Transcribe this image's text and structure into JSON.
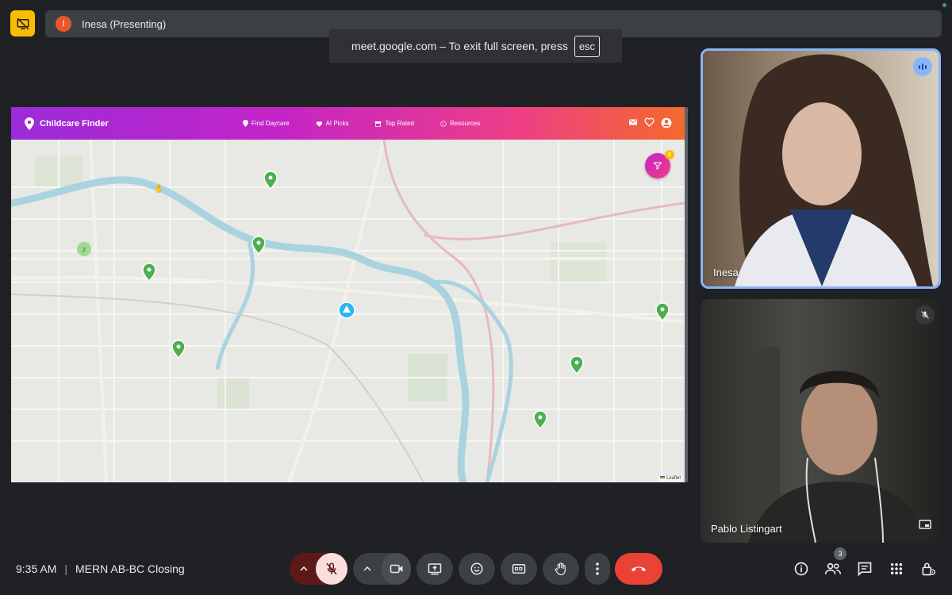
{
  "meet": {
    "presenter_label": "Inesa (Presenting)",
    "presenter_initial": "I",
    "fullscreen_toast": "meet.google.com – To exit full screen, press",
    "esc_key": "esc",
    "time": "9:35 AM",
    "meeting_title": "MERN AB-BC Closing",
    "people_count": "3"
  },
  "app": {
    "brand": "Childcare Finder",
    "nav": [
      {
        "label": "Find Daycare",
        "icon": "pin-icon"
      },
      {
        "label": "AI Picks",
        "icon": "heart-icon"
      },
      {
        "label": "Top Rated",
        "icon": "store-icon"
      },
      {
        "label": "Resources",
        "icon": "info-icon"
      }
    ],
    "filter_count": "6",
    "cluster_count": "2",
    "attribution": "Leaflet"
  },
  "participants": [
    {
      "name": "Inesa",
      "status": "speaking"
    },
    {
      "name": "Pablo Listingart",
      "status": "muted"
    }
  ],
  "colors": {
    "accent_blue": "#8ab4f8",
    "end_call": "#ea4335",
    "present_yellow": "#fbbc04",
    "mic_off_bg": "#f9dedc",
    "marker_green": "#4caf50"
  }
}
